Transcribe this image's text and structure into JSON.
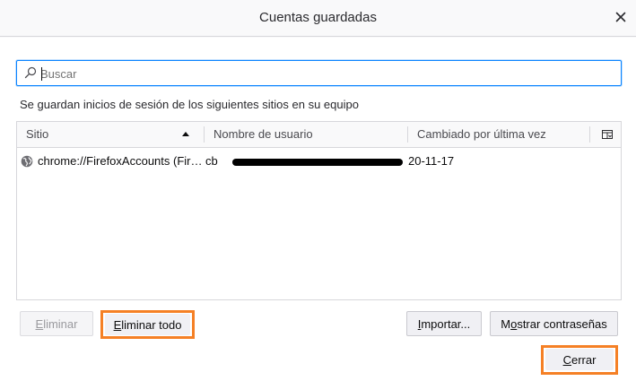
{
  "dialog": {
    "title": "Cuentas guardadas"
  },
  "search": {
    "placeholder": "Buscar",
    "value": ""
  },
  "description": "Se guardan inicios de sesión de los siguientes sitios en su equipo",
  "table": {
    "columns": [
      "Sitio",
      "Nombre de usuario",
      "Cambiado por última vez"
    ],
    "sort_column": "Sitio",
    "sort_direction": "ascending",
    "rows": [
      {
        "site": "chrome://FirefoxAccounts (Fir…",
        "username": "cb",
        "changed": "20-11-17"
      }
    ]
  },
  "buttons": {
    "remove_pre": "",
    "remove_key": "E",
    "remove_post": "liminar",
    "remove_all_pre": "",
    "remove_all_key": "E",
    "remove_all_post": "liminar todo",
    "import_pre": "",
    "import_key": "I",
    "import_post": "mportar...",
    "show_pre": "M",
    "show_key": "o",
    "show_post": "strar contraseñas",
    "close_pre": "",
    "close_key": "C",
    "close_post": "errar"
  },
  "colors": {
    "highlight": "#f58025",
    "focus": "#0a84ff"
  }
}
